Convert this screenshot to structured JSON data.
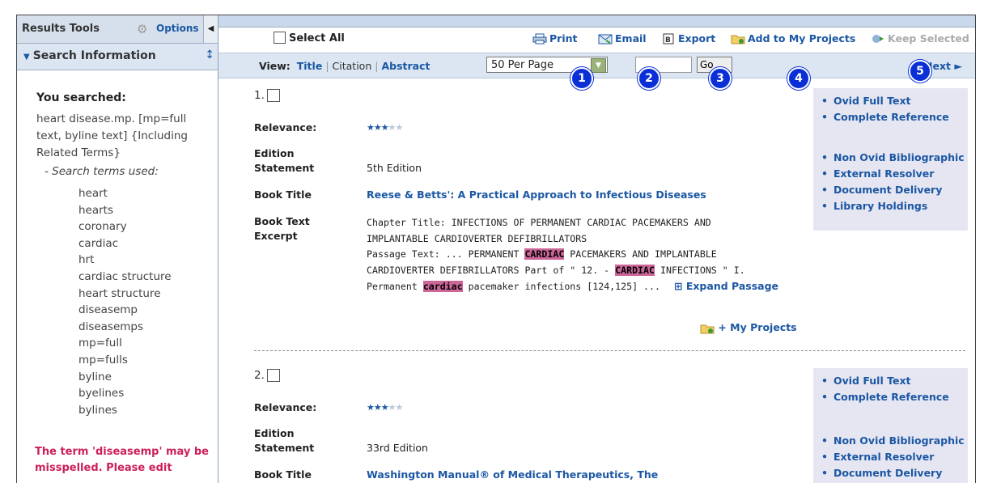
{
  "sidebar": {
    "title": "Results Tools",
    "options_label": "Options",
    "section_title": "Search Information",
    "you_searched_label": "You searched:",
    "query": "heart disease.mp. [mp=full text, byline text] {Including Related Terms}",
    "terms_label": "- Search terms used:",
    "terms": [
      "heart",
      "hearts",
      "coronary",
      "cardiac",
      "hrt",
      "cardiac structure",
      "heart structure",
      "diseasemp",
      "diseasemps",
      "mp=full",
      "mp=fulls",
      "byline",
      "byelines",
      "bylines"
    ],
    "warning": "The term 'diseasemp' may be misspelled. Please edit"
  },
  "toolbar": {
    "select_all": "Select All",
    "print": "Print",
    "email": "Email",
    "export": "Export",
    "add_projects": "Add to My Projects",
    "keep_selected": "Keep Selected"
  },
  "viewbar": {
    "view_label": "View:",
    "title": "Title",
    "citation": "Citation",
    "abstract": "Abstract",
    "per_page": "50 Per Page",
    "page_value": "",
    "go": "Go",
    "next": "Next"
  },
  "badges": [
    "1",
    "2",
    "3",
    "4",
    "5"
  ],
  "labels": {
    "relevance": "Relevance:",
    "edition_1": "Edition",
    "edition_2": "Statement",
    "book_title": "Book Title",
    "excerpt_1": "Book Text",
    "excerpt_2": "Excerpt",
    "expand": "Expand Passage",
    "my_projects": "+ My Projects"
  },
  "results": [
    {
      "num": "1.",
      "relevance_stars": 3,
      "edition": "5th Edition",
      "book_title": "Reese & Betts': A Practical Approach to Infectious Diseases",
      "excerpt": {
        "l1": "Chapter Title: INFECTIONS OF PERMANENT CARDIAC PACEMAKERS AND",
        "l2": "IMPLANTABLE CARDIOVERTER DEFIBRILLATORS",
        "l3a": "Passage Text: ... PERMANENT ",
        "l3hl": "CARDIAC",
        "l3b": " PACEMAKERS AND IMPLANTABLE",
        "l4a": "CARDIOVERTER DEFIBRILLATORS Part of \" 12. - ",
        "l4hl": "CARDIAC",
        "l4b": " INFECTIONS \" I.",
        "l5a": "Permanent ",
        "l5hl": "cardiac",
        "l5b": " pacemaker infections [124,125] ..."
      },
      "links_top": [
        "Ovid Full Text",
        "Complete Reference"
      ],
      "links_bottom": [
        "Non Ovid Bibliographic",
        "External Resolver",
        "Document Delivery",
        "Library Holdings"
      ]
    },
    {
      "num": "2.",
      "relevance_stars": 3,
      "edition": "33rd Edition",
      "book_title": "Washington Manual® of Medical Therapeutics, The",
      "links_top": [
        "Ovid Full Text",
        "Complete Reference"
      ],
      "links_bottom": [
        "Non Ovid Bibliographic",
        "External Resolver",
        "Document Delivery"
      ]
    }
  ]
}
